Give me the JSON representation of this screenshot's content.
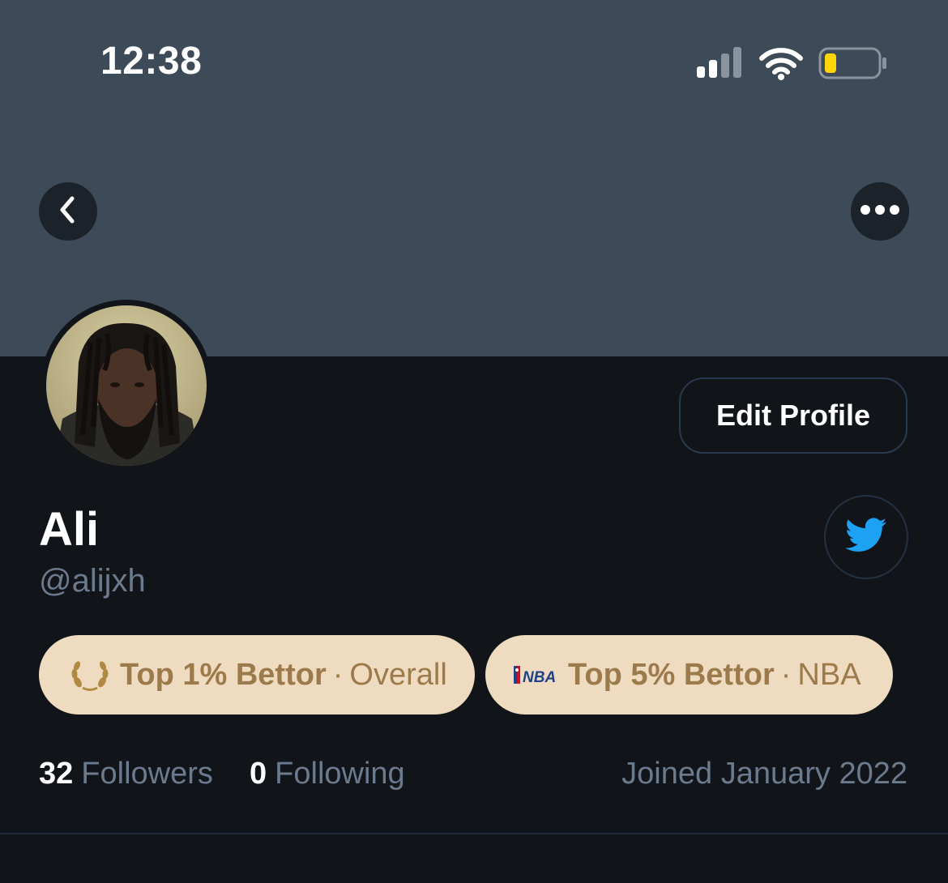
{
  "status_bar": {
    "time": "12:38"
  },
  "profile": {
    "display_name": "Ali",
    "handle": "@alijxh",
    "edit_button_label": "Edit Profile"
  },
  "badges": [
    {
      "icon": "laurel-icon",
      "title": "Top 1% Bettor",
      "separator": "·",
      "category": "Overall"
    },
    {
      "icon": "nba-logo-icon",
      "title": "Top 5% Bettor",
      "separator": "·",
      "category": "NBA"
    }
  ],
  "stats": {
    "followers_count": "32",
    "followers_label": "Followers",
    "following_count": "0",
    "following_label": "Following",
    "joined": "Joined January 2022"
  },
  "colors": {
    "banner": "#3d4a57",
    "background": "#111419",
    "badge_bg": "#efdcc0",
    "badge_text": "#9c7a4c",
    "muted_text": "#6b7a8c",
    "twitter_blue": "#1da1f2",
    "battery_level": "#ffd60a"
  }
}
